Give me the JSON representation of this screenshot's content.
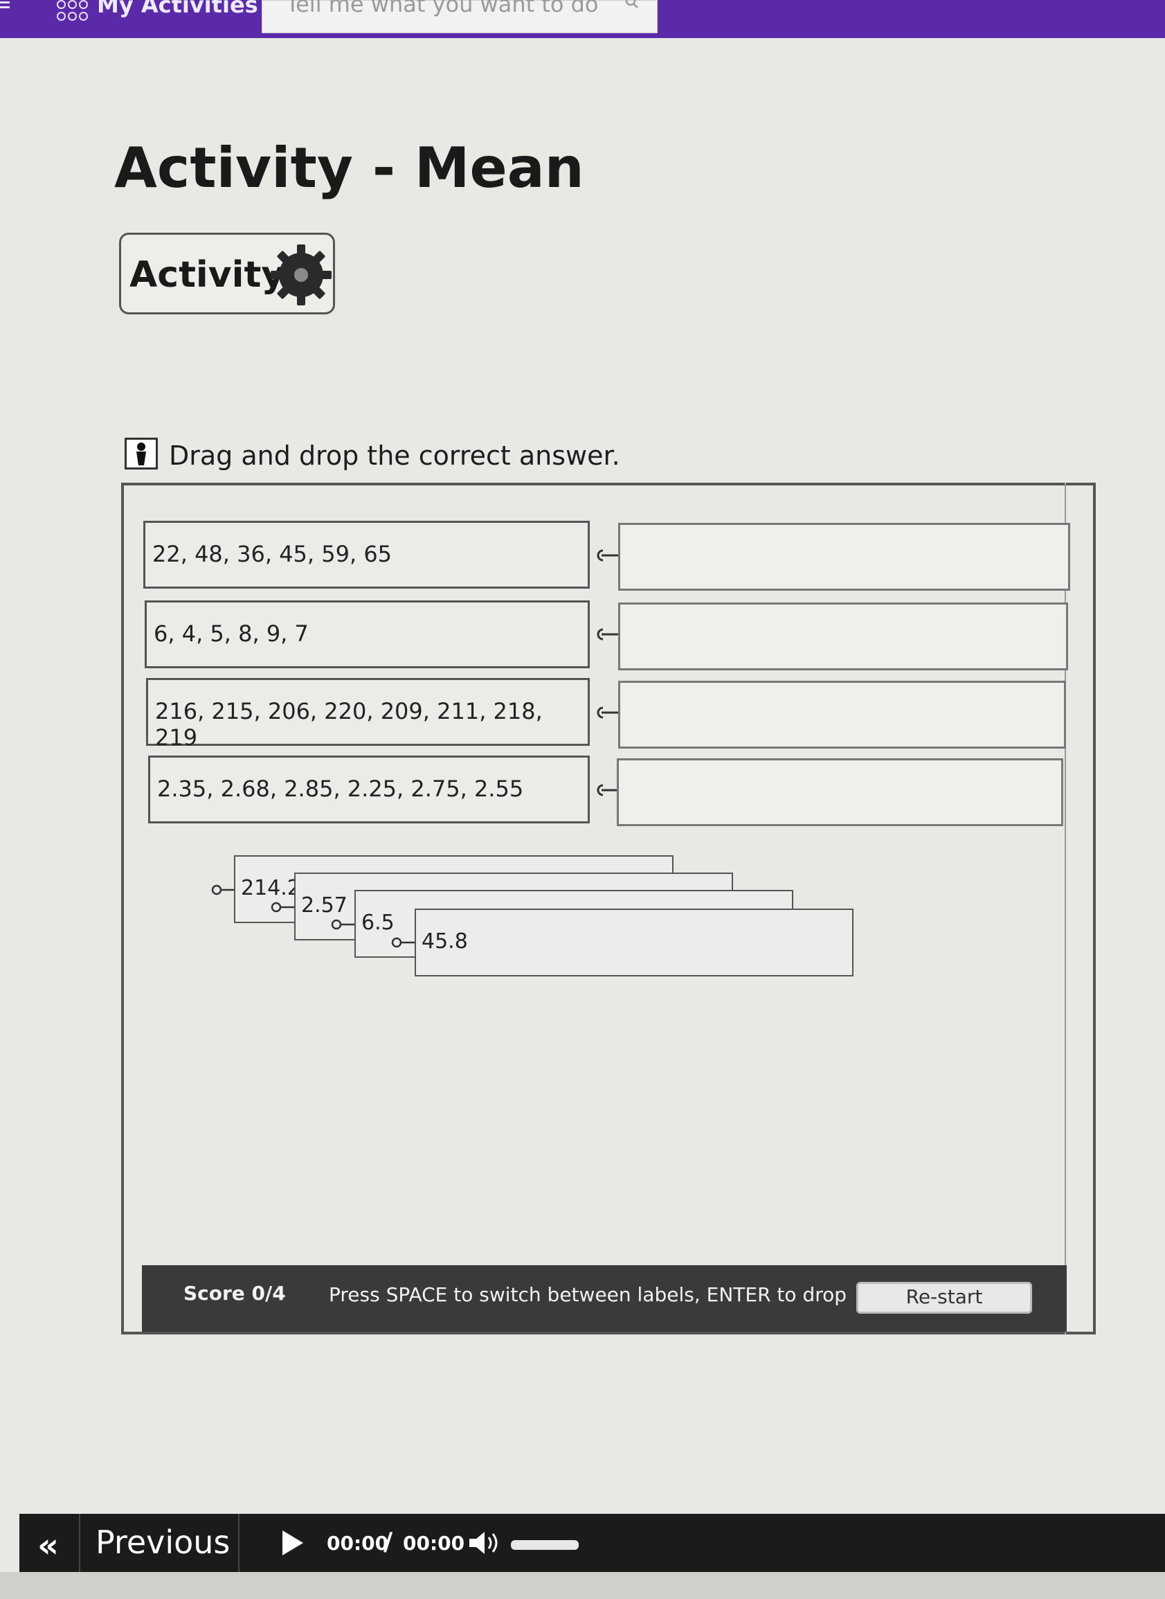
{
  "topbar": {
    "app_title": "My Activities",
    "search_placeholder": "Tell me what you want to do"
  },
  "page": {
    "title": "Activity - Mean",
    "badge_label": "Activity",
    "instructions": "Drag and drop the correct answer."
  },
  "questions": [
    {
      "text": "22, 48, 36, 45, 59, 65"
    },
    {
      "text": "6, 4, 5, 8, 9, 7"
    },
    {
      "text": "216, 215, 206, 220, 209, 211, 218, 219"
    },
    {
      "text": "2.35, 2.68, 2.85, 2.25, 2.75, 2.55"
    }
  ],
  "answer_labels": [
    {
      "text": "214.2"
    },
    {
      "text": "2.57"
    },
    {
      "text": "6.5"
    },
    {
      "text": "45.8"
    }
  ],
  "footer": {
    "score": "Score 0/4",
    "hint": "Press SPACE to switch between labels, ENTER to drop",
    "restart_label": "Re-start"
  },
  "player": {
    "prev_chevron": "«",
    "prev_label": "Previous",
    "time_current": "00:00",
    "time_separator": "/",
    "time_total": "00:00"
  },
  "colors": {
    "topbar": "#5b2aa8",
    "footer_bar": "#3a3a3a",
    "player_bar": "#1b1b1b"
  }
}
